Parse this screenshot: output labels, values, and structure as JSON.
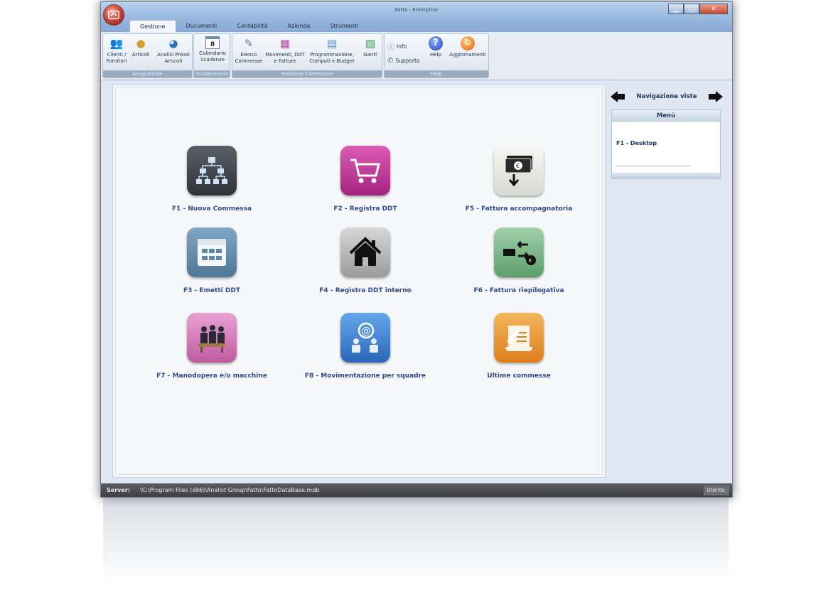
{
  "window": {
    "title": "Fatto - Enterprise"
  },
  "tabs": [
    "Gestione",
    "Documenti",
    "Contabilità",
    "Azienda",
    "Strumenti"
  ],
  "ribbon": {
    "groups": [
      {
        "label": "Anagrafiche",
        "buttons": [
          {
            "label": "Clienti / Fornitori",
            "icon": "people-icon"
          },
          {
            "label": "Articoli",
            "icon": "articles-icon"
          },
          {
            "label": "Analisi Prezzi Articoli",
            "icon": "price-analysis-icon"
          }
        ]
      },
      {
        "label": "Scadenziario",
        "buttons": [
          {
            "label": "Calendario Scadenze",
            "icon": "calendar-icon",
            "badge": "8"
          }
        ]
      },
      {
        "label": "Gestione Commesse",
        "buttons": [
          {
            "label": "Elenco Commesse",
            "icon": "list-icon"
          },
          {
            "label": "Movimenti, DdT e Fatture",
            "icon": "movements-icon"
          },
          {
            "label": "Programmazione, Computi e Budget",
            "icon": "planning-icon"
          },
          {
            "label": "Gantt",
            "icon": "gantt-icon"
          }
        ]
      },
      {
        "label": "Help",
        "small": [
          {
            "label": "Info",
            "icon": "info-icon"
          },
          {
            "label": "Supporto",
            "icon": "support-icon"
          }
        ],
        "buttons": [
          {
            "label": "Help",
            "icon": "help-icon"
          },
          {
            "label": "Aggiornamenti",
            "icon": "update-icon"
          }
        ]
      }
    ]
  },
  "tiles": [
    {
      "label": "F1 - Nuova Commessa",
      "icon": "hierarchy-icon",
      "color": "#3c4148"
    },
    {
      "label": "F2 - Registra DDT",
      "icon": "cart-icon",
      "color": "#c23c9a"
    },
    {
      "label": "F5 - Fattura accompagnatoria",
      "icon": "money-down-icon",
      "color": "#e6e6e2"
    },
    {
      "label": "F3 - Emetti DDT",
      "icon": "grid-icon",
      "color": "#5f89a9"
    },
    {
      "label": "F4 - Registra DDT interno",
      "icon": "house-icon",
      "color": "#b8b8b8"
    },
    {
      "label": "F6 - Fattura riepilogativa",
      "icon": "exchange-icon",
      "color": "#7fb88a"
    },
    {
      "label": "F7 - Manodopera e/o macchine",
      "icon": "workers-icon",
      "color": "#d47ab6"
    },
    {
      "label": "F8 - Movimentazione per squadre",
      "icon": "team-at-icon",
      "color": "#3f7fc8"
    },
    {
      "label": "Ultime commesse",
      "icon": "document-pen-icon",
      "color": "#e99a3a"
    }
  ],
  "side": {
    "nav_label": "Navigazione viste",
    "menu_title": "Menù",
    "menu_items": [
      "F1 - Desktop"
    ]
  },
  "status": {
    "server_label": "Server:",
    "path": "\\C:\\Program Files (x86)\\Analist Group\\Fatto\\FattoDataBase.mdb",
    "user_label": "Utente:"
  }
}
